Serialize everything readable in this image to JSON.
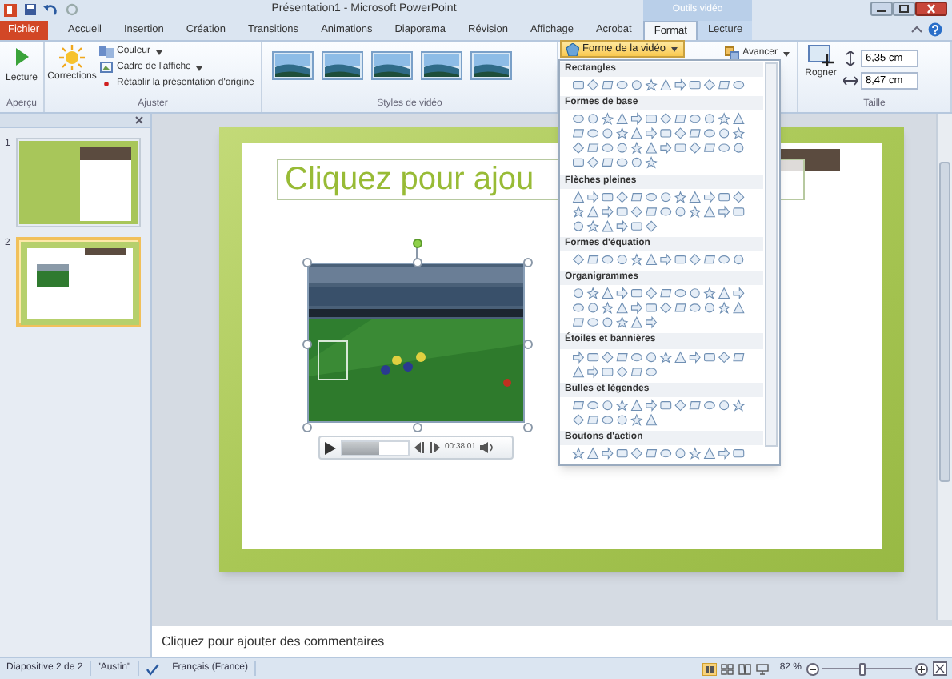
{
  "window": {
    "title": "Présentation1 - Microsoft PowerPoint"
  },
  "contextual_group": {
    "label": "Outils vidéo"
  },
  "tabs": [
    {
      "label": "Fichier",
      "kind": "file",
      "selected": false
    },
    {
      "label": "Accueil",
      "kind": "tab",
      "selected": false
    },
    {
      "label": "Insertion",
      "kind": "tab",
      "selected": false
    },
    {
      "label": "Création",
      "kind": "tab",
      "selected": false
    },
    {
      "label": "Transitions",
      "kind": "tab",
      "selected": false
    },
    {
      "label": "Animations",
      "kind": "tab",
      "selected": false
    },
    {
      "label": "Diaporama",
      "kind": "tab",
      "selected": false
    },
    {
      "label": "Révision",
      "kind": "tab",
      "selected": false
    },
    {
      "label": "Affichage",
      "kind": "tab",
      "selected": false
    },
    {
      "label": "Acrobat",
      "kind": "tab",
      "selected": false
    },
    {
      "label": "Format",
      "kind": "contextual",
      "selected": true
    },
    {
      "label": "Lecture",
      "kind": "contextual",
      "selected": false
    }
  ],
  "ribbon": {
    "preview_group": {
      "label": "Aperçu",
      "button": "Lecture"
    },
    "adjust_group": {
      "label": "Ajuster",
      "corrections": "Corrections",
      "commands": [
        "Couleur",
        "Cadre de l'affiche",
        "Rétablir la présentation d'origine"
      ]
    },
    "styles_group": {
      "label": "Styles de vidéo"
    },
    "arrange_group": {
      "forward": "Avancer"
    },
    "size_group": {
      "label": "Taille",
      "crop": "Rogner",
      "height": "6,35 cm",
      "width": "8,47 cm"
    }
  },
  "video_shape_menu": {
    "button": "Forme de la vidéo",
    "sections": [
      {
        "title": "Rectangles"
      },
      {
        "title": "Formes de base"
      },
      {
        "title": "Flèches pleines"
      },
      {
        "title": "Formes d'équation"
      },
      {
        "title": "Organigrammes"
      },
      {
        "title": "Étoiles et bannières"
      },
      {
        "title": "Bulles et légendes"
      },
      {
        "title": "Boutons d'action"
      }
    ]
  },
  "slide_panel": {
    "thumbnails": [
      {
        "number": "1",
        "selected": false
      },
      {
        "number": "2",
        "selected": true
      }
    ]
  },
  "slide": {
    "title_placeholder": "Cliquez pour ajou",
    "video": {
      "kind": "picture",
      "time": "00:38.01",
      "level": 0.55
    }
  },
  "notes": {
    "text": "Cliquez pour ajouter des commentaires"
  },
  "status_bar": {
    "slide_info": "Diapositive 2 de 2",
    "theme": "\"Austin\"",
    "language": "Français (France)",
    "zoom": "82 %",
    "level": 0.45
  }
}
